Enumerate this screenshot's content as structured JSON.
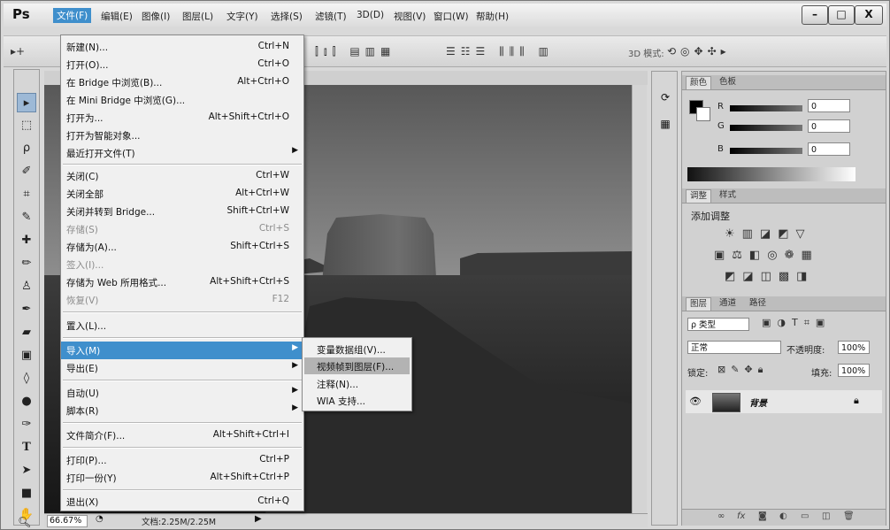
{
  "app": {
    "logo": "Ps"
  },
  "menubar": {
    "items": [
      "文件(F)",
      "编辑(E)",
      "图像(I)",
      "图层(L)",
      "文字(Y)",
      "选择(S)",
      "滤镜(T)",
      "3D(D)",
      "视图(V)",
      "窗口(W)",
      "帮助(H)"
    ],
    "window_buttons": [
      "–",
      "□",
      "X"
    ]
  },
  "optionsbar": {
    "mode_3d_label": "3D 模式:"
  },
  "file_menu": {
    "items": [
      {
        "label": "新建(N)...",
        "shortcut": "Ctrl+N"
      },
      {
        "label": "打开(O)...",
        "shortcut": "Ctrl+O"
      },
      {
        "label": "在 Bridge 中浏览(B)...",
        "shortcut": "Alt+Ctrl+O"
      },
      {
        "label": "在 Mini Bridge 中浏览(G)...",
        "shortcut": ""
      },
      {
        "label": "打开为...",
        "shortcut": "Alt+Shift+Ctrl+O"
      },
      {
        "label": "打开为智能对象...",
        "shortcut": ""
      },
      {
        "label": "最近打开文件(T)",
        "shortcut": ""
      },
      {
        "label": "关闭(C)",
        "shortcut": "Ctrl+W"
      },
      {
        "label": "关闭全部",
        "shortcut": "Alt+Ctrl+W"
      },
      {
        "label": "关闭并转到 Bridge...",
        "shortcut": "Shift+Ctrl+W"
      },
      {
        "label": "存储(S)",
        "shortcut": "Ctrl+S"
      },
      {
        "label": "存储为(A)...",
        "shortcut": "Shift+Ctrl+S"
      },
      {
        "label": "签入(I)...",
        "shortcut": ""
      },
      {
        "label": "存储为 Web 所用格式...",
        "shortcut": "Alt+Shift+Ctrl+S"
      },
      {
        "label": "恢复(V)",
        "shortcut": "F12"
      },
      {
        "label": "置入(L)...",
        "shortcut": ""
      },
      {
        "label": "导入(M)",
        "shortcut": ""
      },
      {
        "label": "导出(E)",
        "shortcut": ""
      },
      {
        "label": "自动(U)",
        "shortcut": ""
      },
      {
        "label": "脚本(R)",
        "shortcut": ""
      },
      {
        "label": "文件简介(F)...",
        "shortcut": "Alt+Shift+Ctrl+I"
      },
      {
        "label": "打印(P)...",
        "shortcut": "Ctrl+P"
      },
      {
        "label": "打印一份(Y)",
        "shortcut": "Alt+Shift+Ctrl+P"
      },
      {
        "label": "退出(X)",
        "shortcut": "Ctrl+Q"
      }
    ]
  },
  "import_submenu": {
    "items": [
      "变量数据组(V)...",
      "视频帧到图层(F)...",
      "注释(N)...",
      "WIA 支持..."
    ]
  },
  "status": {
    "zoom": "66.67%",
    "doc": "文档:2.25M/2.25M"
  },
  "color_panel": {
    "tabs": [
      "颜色",
      "色板"
    ],
    "channels": [
      {
        "label": "R",
        "value": "0"
      },
      {
        "label": "G",
        "value": "0"
      },
      {
        "label": "B",
        "value": "0"
      }
    ]
  },
  "adjust_panel": {
    "tabs": [
      "调整",
      "样式"
    ],
    "title": "添加调整"
  },
  "layers_panel": {
    "tabs": [
      "图层",
      "通道",
      "路径"
    ],
    "filter": "ρ 类型",
    "blend_mode": "正常",
    "opacity_label": "不透明度:",
    "opacity": "100%",
    "lock_label": "锁定:",
    "fill_label": "填充:",
    "fill": "100%",
    "layer_name": "背景"
  }
}
